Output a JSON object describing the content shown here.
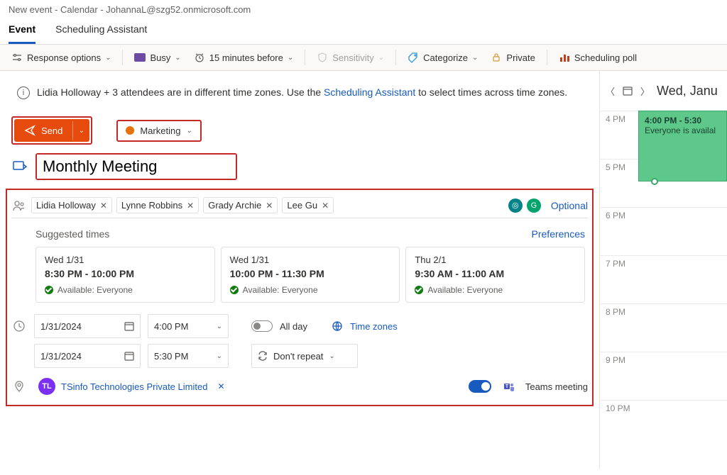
{
  "window_title": "New event - Calendar - JohannaL@szg52.onmicrosoft.com",
  "tabs": {
    "event": "Event",
    "scheduling": "Scheduling Assistant"
  },
  "toolbar": {
    "response": "Response options",
    "busy": "Busy",
    "reminder": "15 minutes before",
    "sensitivity": "Sensitivity",
    "categorize": "Categorize",
    "private": "Private",
    "poll": "Scheduling poll"
  },
  "infobar": {
    "text1": "Lidia Holloway + 3 attendees are in different time zones. Use the ",
    "link": "Scheduling Assistant",
    "text2": " to select times across time zones."
  },
  "send": "Send",
  "calendar_category": "Marketing",
  "title": "Monthly Meeting",
  "attendees": [
    "Lidia Holloway",
    "Lynne Robbins",
    "Grady Archie",
    "Lee Gu"
  ],
  "optional": "Optional",
  "suggested_label": "Suggested times",
  "preferences": "Preferences",
  "suggestions": [
    {
      "date": "Wed 1/31",
      "time": "8:30 PM - 10:00 PM",
      "avail": "Available: Everyone"
    },
    {
      "date": "Wed 1/31",
      "time": "10:00 PM - 11:30 PM",
      "avail": "Available: Everyone"
    },
    {
      "date": "Thu 2/1",
      "time": "9:30 AM - 11:00 AM",
      "avail": "Available: Everyone"
    }
  ],
  "start_date": "1/31/2024",
  "start_time": "4:00 PM",
  "end_date": "1/31/2024",
  "end_time": "5:30 PM",
  "all_day": "All day",
  "time_zones": "Time zones",
  "repeat": "Don't repeat",
  "location": "TSinfo Technologies Private Limited",
  "location_initials": "TL",
  "teams_meeting": "Teams meeting",
  "sidepanel": {
    "day_label": "Wed, Janu",
    "hours": [
      "4 PM",
      "5 PM",
      "6 PM",
      "7 PM",
      "8 PM",
      "9 PM",
      "10 PM"
    ],
    "event_time": "4:00 PM - 5:30",
    "event_avail": "Everyone is availal"
  }
}
